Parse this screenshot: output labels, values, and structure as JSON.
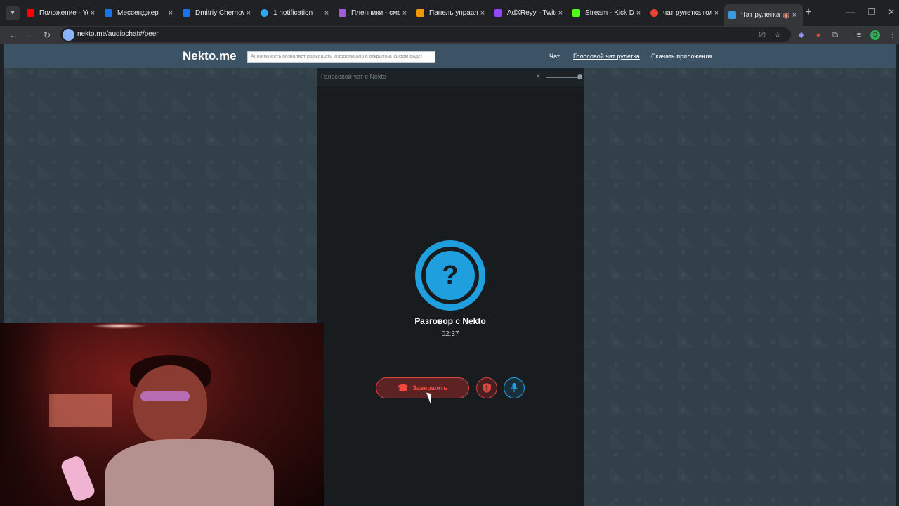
{
  "browser": {
    "tabs": [
      {
        "title": "Положение - You",
        "color": "#ff0000"
      },
      {
        "title": "Мессенджер",
        "color": "#1a73e8"
      },
      {
        "title": "Dmitriy Chernov",
        "color": "#1a73e8"
      },
      {
        "title": "1 notification",
        "color": "#2aabee"
      },
      {
        "title": "Пленники - смот",
        "color": "#a05cd8"
      },
      {
        "title": "Панель управлен",
        "color": "#f29900"
      },
      {
        "title": "AdXReyy - Twitch",
        "color": "#9146ff"
      },
      {
        "title": "Stream - Kick Das",
        "color": "#53fc18"
      },
      {
        "title": "чат рулетка голо",
        "color": "#ea4335"
      },
      {
        "title": "Чат рулетка г",
        "color": "#3c9bd8",
        "active": true
      }
    ],
    "url": "nekto.me/audiochat#/peer"
  },
  "site": {
    "logo": "Nekto.me",
    "notice": "Анонимность позволяет размещать информацию в открытом, сыром виде!",
    "nav": [
      "Чат",
      "Голосовой чат рулетка",
      "Скачать приложения"
    ]
  },
  "panel": {
    "title": "Голосовой чат с Nekto",
    "avatar_symbol": "?",
    "peer_name": "Разговор с Nekto",
    "timer": "02:37",
    "end_label": "Завершить",
    "volume": 0.9
  },
  "colors": {
    "accent": "#1f9fdd",
    "danger": "#e0443f",
    "header": "#3c5366"
  }
}
